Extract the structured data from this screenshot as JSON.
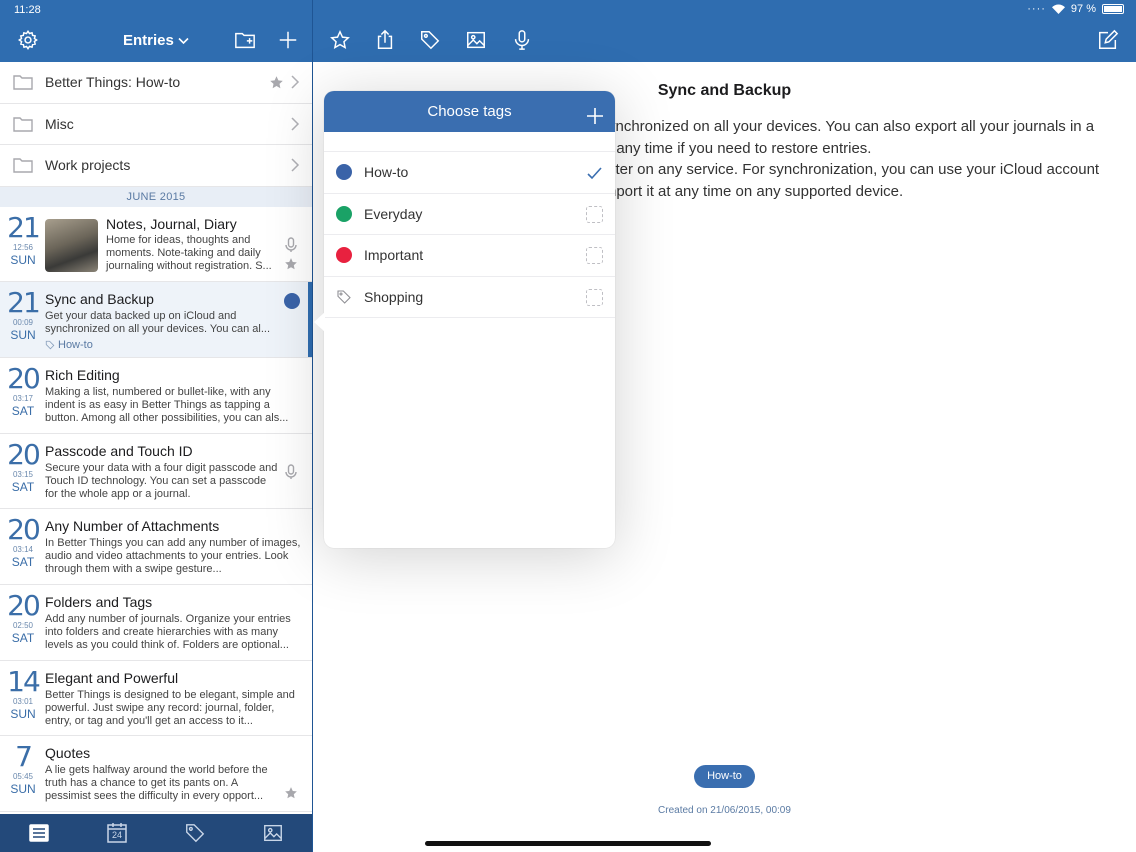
{
  "status": {
    "time": "11:28",
    "battery": "97 %"
  },
  "sidebar_header": {
    "title": "Entries"
  },
  "folders": [
    {
      "label": "Better Things: How-to",
      "starred": true
    },
    {
      "label": "Misc"
    },
    {
      "label": "Work projects"
    }
  ],
  "section": {
    "label": "JUNE 2015"
  },
  "entries": [
    {
      "day": "21",
      "time": "12:56",
      "dow": "SUN",
      "title": "Notes, Journal, Diary",
      "body": "Home for ideas, thoughts and moments. Note-taking and daily journaling without registration. S...",
      "has_thumb": true,
      "icons": [
        "microphone-icon",
        "star-icon"
      ]
    },
    {
      "day": "21",
      "time": "00:09",
      "dow": "SUN",
      "title": "Sync and Backup",
      "body": "Get your data backed up on iCloud and synchronized on all your devices. You can al...",
      "tag": "How-to",
      "selected": true
    },
    {
      "day": "20",
      "time": "03:17",
      "dow": "SAT",
      "title": "Rich Editing",
      "body": "Making a list, numbered or bullet-like, with any indent is as easy in Better Things as tapping a button. Among all other possibilities, you can als..."
    },
    {
      "day": "20",
      "time": "03:15",
      "dow": "SAT",
      "title": "Passcode and Touch ID",
      "body": "Secure your data with a four digit passcode and Touch ID technology. You can set a passcode for the whole app or a journal.",
      "icons": [
        "microphone-icon"
      ]
    },
    {
      "day": "20",
      "time": "03:14",
      "dow": "SAT",
      "title": "Any Number of Attachments",
      "body": "In Better Things you can add any number of images, audio and video attachments to your entries. Look through them with a swipe gesture..."
    },
    {
      "day": "20",
      "time": "02:50",
      "dow": "SAT",
      "title": "Folders and Tags",
      "body": "Add any number of journals. Organize your entries into folders and create hierarchies with as many levels as you could think of. Folders are optional..."
    },
    {
      "day": "14",
      "time": "03:01",
      "dow": "SUN",
      "title": "Elegant and Powerful",
      "body": "Better Things is designed to be elegant, simple and powerful. Just swipe any record: journal, folder, entry, or tag and you'll get an access to it..."
    },
    {
      "day": "7",
      "time": "05:45",
      "dow": "SUN",
      "title": "Quotes",
      "body": "A lie gets halfway around the world before the truth has a chance to get its pants on.  A pessimist sees the difficulty in every opport...",
      "icons": [
        "star-icon"
      ]
    }
  ],
  "tabbar": {
    "calendar_day": "24"
  },
  "document": {
    "title": "Sync and Backup",
    "text": "ynchronized on all your devices. You can also export all your journals in a\nt any time if you need to restore entries.\nster on any service. For synchronization, you can use your iCloud account\nnport it at any time on any supported device.",
    "tag": "How-to",
    "created": "Created on 21/06/2015, 00:09"
  },
  "popover": {
    "title": "Choose tags",
    "tags": [
      {
        "label": "How-to",
        "color": "#3a63a8",
        "checked": true
      },
      {
        "label": "Everyday",
        "color": "#1aa266",
        "checked": false
      },
      {
        "label": "Important",
        "color": "#e8213f",
        "checked": false
      },
      {
        "label": "Shopping",
        "icon": "tag-icon",
        "checked": false
      }
    ]
  },
  "colors": {
    "bar": "#2f6db0",
    "tabbar": "#23497a",
    "accent": "#3a6eb0"
  }
}
